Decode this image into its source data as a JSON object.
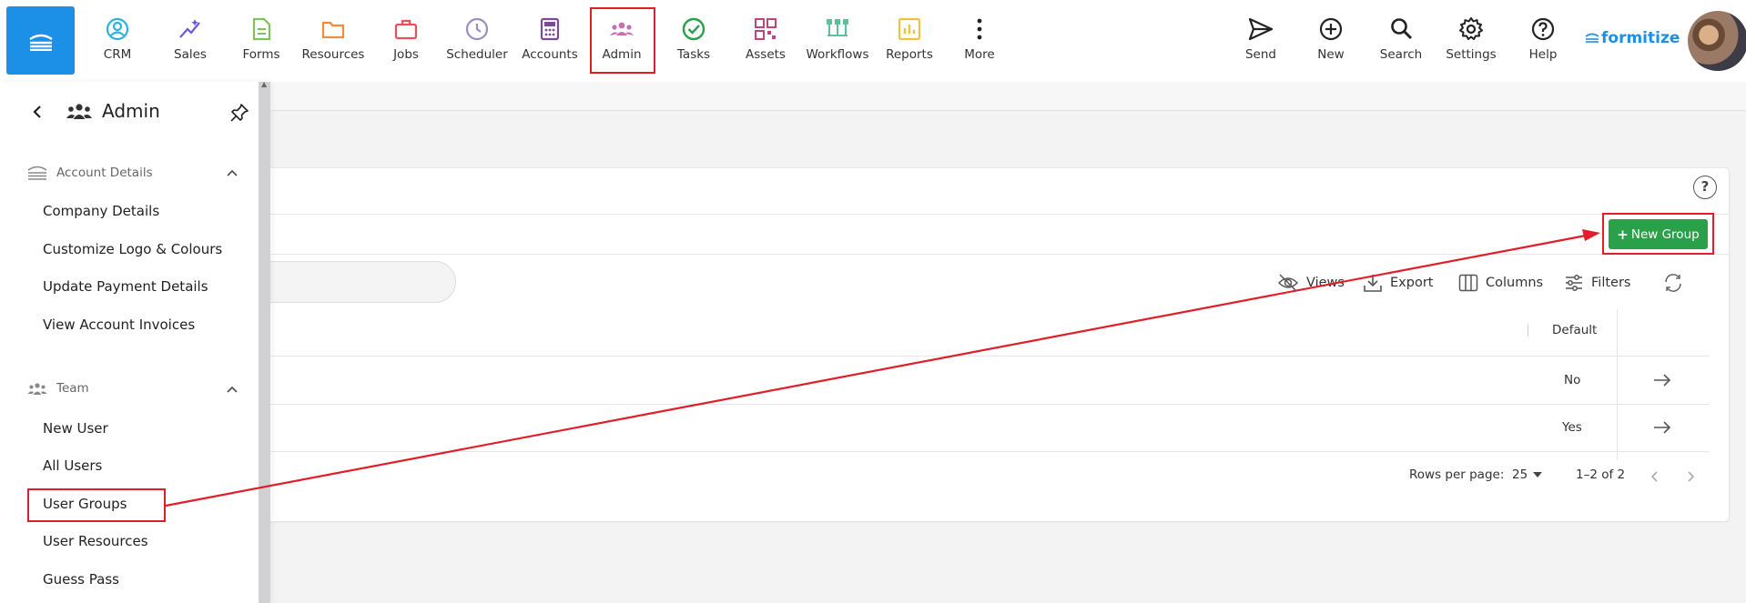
{
  "nav": {
    "items": [
      {
        "label": "CRM",
        "icon": "crm-icon",
        "color": "#2db3d9"
      },
      {
        "label": "Sales",
        "icon": "sales-icon",
        "color": "#6a5bd6"
      },
      {
        "label": "Forms",
        "icon": "forms-icon",
        "color": "#7cc35b"
      },
      {
        "label": "Resources",
        "icon": "resources-icon",
        "color": "#f08c3c"
      },
      {
        "label": "Jobs",
        "icon": "jobs-icon",
        "color": "#e8505b"
      },
      {
        "label": "Scheduler",
        "icon": "scheduler-icon",
        "color": "#9a8fc0"
      },
      {
        "label": "Accounts",
        "icon": "accounts-icon",
        "color": "#7b4a92"
      },
      {
        "label": "Admin",
        "icon": "admin-icon",
        "color": "#c76fb6"
      },
      {
        "label": "Tasks",
        "icon": "tasks-icon",
        "color": "#2aa04a"
      },
      {
        "label": "Assets",
        "icon": "assets-icon",
        "color": "#c2447f"
      },
      {
        "label": "Workflows",
        "icon": "workflows-icon",
        "color": "#5fbf9a"
      },
      {
        "label": "Reports",
        "icon": "reports-icon",
        "color": "#f2c13a"
      },
      {
        "label": "More",
        "icon": "more-icon",
        "color": "#222222"
      }
    ],
    "right": [
      {
        "label": "Send",
        "icon": "send-icon"
      },
      {
        "label": "New",
        "icon": "plus-circle-icon"
      },
      {
        "label": "Search",
        "icon": "search-icon"
      },
      {
        "label": "Settings",
        "icon": "gear-icon"
      },
      {
        "label": "Help",
        "icon": "help-icon"
      }
    ],
    "brand": "formitize",
    "accent": "#1c8fe6"
  },
  "sidebar": {
    "title": "Admin",
    "sections": [
      {
        "label": "Account Details",
        "items": [
          "Company Details",
          "Customize Logo & Colours",
          "Update Payment Details",
          "View Account Invoices"
        ]
      },
      {
        "label": "Team",
        "items": [
          "New User",
          "All Users",
          "User Groups",
          "User Resources",
          "Guess Pass"
        ]
      }
    ]
  },
  "main": {
    "new_group_label": "New Group",
    "toolbar": {
      "views": "Views",
      "export": "Export",
      "columns": "Columns",
      "filters": "Filters"
    },
    "table": {
      "header_default": "Default",
      "rows": [
        {
          "default": "No"
        },
        {
          "default": "Yes"
        }
      ]
    },
    "pager": {
      "rows_per_page_label": "Rows per page:",
      "rows_per_page": "25",
      "range": "1–2 of 2"
    },
    "help_glyph": "?"
  }
}
